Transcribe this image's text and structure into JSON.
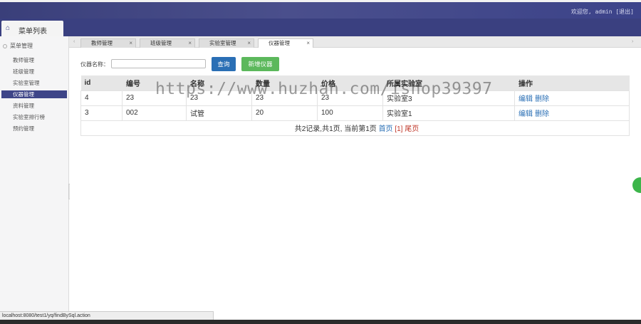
{
  "header": {
    "user_text": "欢迎您, admin [退出]"
  },
  "menu_tab": {
    "label": "菜单列表"
  },
  "sidebar": {
    "group": "菜单管理",
    "items": [
      {
        "label": "教师管理",
        "active": false
      },
      {
        "label": "班级管理",
        "active": false
      },
      {
        "label": "实验室管理",
        "active": false
      },
      {
        "label": "仪器管理",
        "active": true
      },
      {
        "label": "资料管理",
        "active": false
      },
      {
        "label": "实验室排行榜",
        "active": false
      },
      {
        "label": "预约管理",
        "active": false
      }
    ]
  },
  "tabs": [
    {
      "label": "教师管理",
      "close": "×"
    },
    {
      "label": "班级管理",
      "close": "×"
    },
    {
      "label": "实验室管理",
      "close": "×"
    },
    {
      "label": "仪器管理",
      "close": "×",
      "active": true
    }
  ],
  "search": {
    "label": "仪器名称：",
    "value": "",
    "query_button": "查询",
    "add_button": "新增仪器"
  },
  "table": {
    "columns": [
      "id",
      "编号",
      "名称",
      "数量",
      "价格",
      "所属实验室",
      "操作"
    ],
    "rows": [
      {
        "id": "4",
        "code": "23",
        "name": "23",
        "qty": "23",
        "price": "23",
        "lab": "实验室3",
        "edit": "编辑",
        "delete": "删除"
      },
      {
        "id": "3",
        "code": "002",
        "name": "试管",
        "qty": "20",
        "price": "100",
        "lab": "实验室1",
        "edit": "编辑",
        "delete": "删除"
      }
    ]
  },
  "pager": {
    "summary": "共2记录,共1页, 当前第1页",
    "first": "首页",
    "current": "[1]",
    "last": "尾页"
  },
  "watermark": "https://www.huzhan.com/ishop39397",
  "status_url": "localhost:8080/test1/yq/findBySql.action",
  "colors": {
    "header": "#3a4080",
    "query_button": "#2a6fb5",
    "add_button": "#5cb85c",
    "active_sidebar": "#3e4588"
  }
}
